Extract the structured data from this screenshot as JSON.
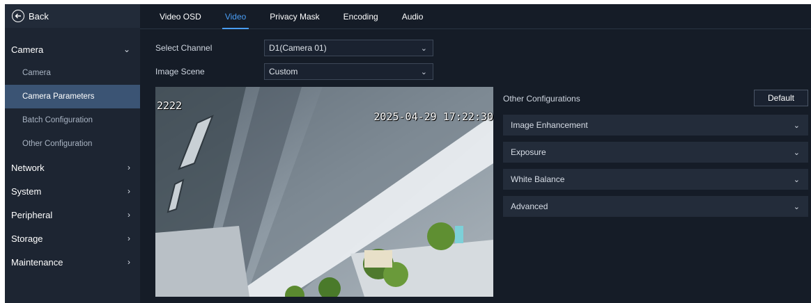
{
  "sidebar": {
    "back_label": "Back",
    "items": [
      {
        "label": "Camera",
        "chevron": "⌄"
      },
      {
        "label": "Camera"
      },
      {
        "label": "Camera Parameters"
      },
      {
        "label": "Batch Configuration"
      },
      {
        "label": "Other Configuration"
      },
      {
        "label": "Network",
        "chevron": "›"
      },
      {
        "label": "System",
        "chevron": "›"
      },
      {
        "label": "Peripheral",
        "chevron": "›"
      },
      {
        "label": "Storage",
        "chevron": "›"
      },
      {
        "label": "Maintenance",
        "chevron": "›"
      }
    ]
  },
  "tabs": [
    {
      "label": "Video OSD"
    },
    {
      "label": "Video"
    },
    {
      "label": "Privacy Mask"
    },
    {
      "label": "Encoding"
    },
    {
      "label": "Audio"
    }
  ],
  "form": {
    "channel_label": "Select Channel",
    "channel_value": "D1(Camera 01)",
    "scene_label": "Image Scene",
    "scene_value": "Custom"
  },
  "video": {
    "osd_name": "2222",
    "osd_time": "2025-04-29 17:22:30"
  },
  "panel": {
    "title": "Other Configurations",
    "default_label": "Default",
    "sections": [
      {
        "label": "Image Enhancement"
      },
      {
        "label": "Exposure"
      },
      {
        "label": "White Balance"
      },
      {
        "label": "Advanced"
      }
    ]
  },
  "colors": {
    "accent": "#4a9ef5",
    "active_item": "#3b5474",
    "background": "#151c27"
  }
}
